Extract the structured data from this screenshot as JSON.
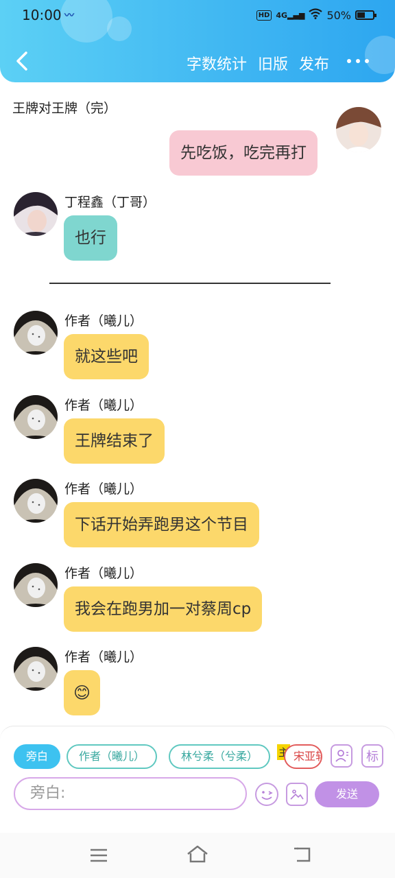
{
  "status_bar": {
    "time": "10:00",
    "network_badge": "HD",
    "signal": "4G",
    "battery": "50%",
    "battery_level": 0.5
  },
  "nav": {
    "word_count": "字数统计",
    "old_version": "旧版",
    "publish": "发布"
  },
  "chapter_title": "王牌对王牌（完）",
  "messages": [
    {
      "side": "right",
      "text": "先吃饭，吃完再打",
      "color": "pink"
    },
    {
      "sender": "丁程鑫（丁哥）",
      "text": "也行",
      "color": "teal"
    },
    {
      "sender": "作者（曦儿）",
      "text": "就这些吧",
      "color": "yellow"
    },
    {
      "sender": "作者（曦儿）",
      "text": "王牌结束了",
      "color": "yellow"
    },
    {
      "sender": "作者（曦儿）",
      "text": "下话开始弄跑男这个节目",
      "color": "yellow"
    },
    {
      "sender": "作者（曦儿）",
      "text": "我会在跑男加一对蔡周cp",
      "color": "yellow"
    },
    {
      "sender": "作者（曦儿）",
      "text": "😊",
      "color": "yellow"
    }
  ],
  "toolbar": {
    "chips": [
      "旁白",
      "作者（曦儿）",
      "林兮柔（兮柔）",
      "宋亚轩"
    ],
    "main_tag": "主",
    "mark_label": "标",
    "input_placeholder": "旁白:",
    "send_label": "发送"
  },
  "colors": {
    "header": "#3fb6f2",
    "yellow_bubble": "#fcd86b",
    "teal_bubble": "#7fd6cf",
    "pink_bubble": "#f8c9d3",
    "send": "#c191e6"
  },
  "icons": [
    "back-arrow-icon",
    "more-icon",
    "profile-icon",
    "emoji-icon",
    "image-icon",
    "menu-icon",
    "home-icon",
    "back-icon"
  ]
}
